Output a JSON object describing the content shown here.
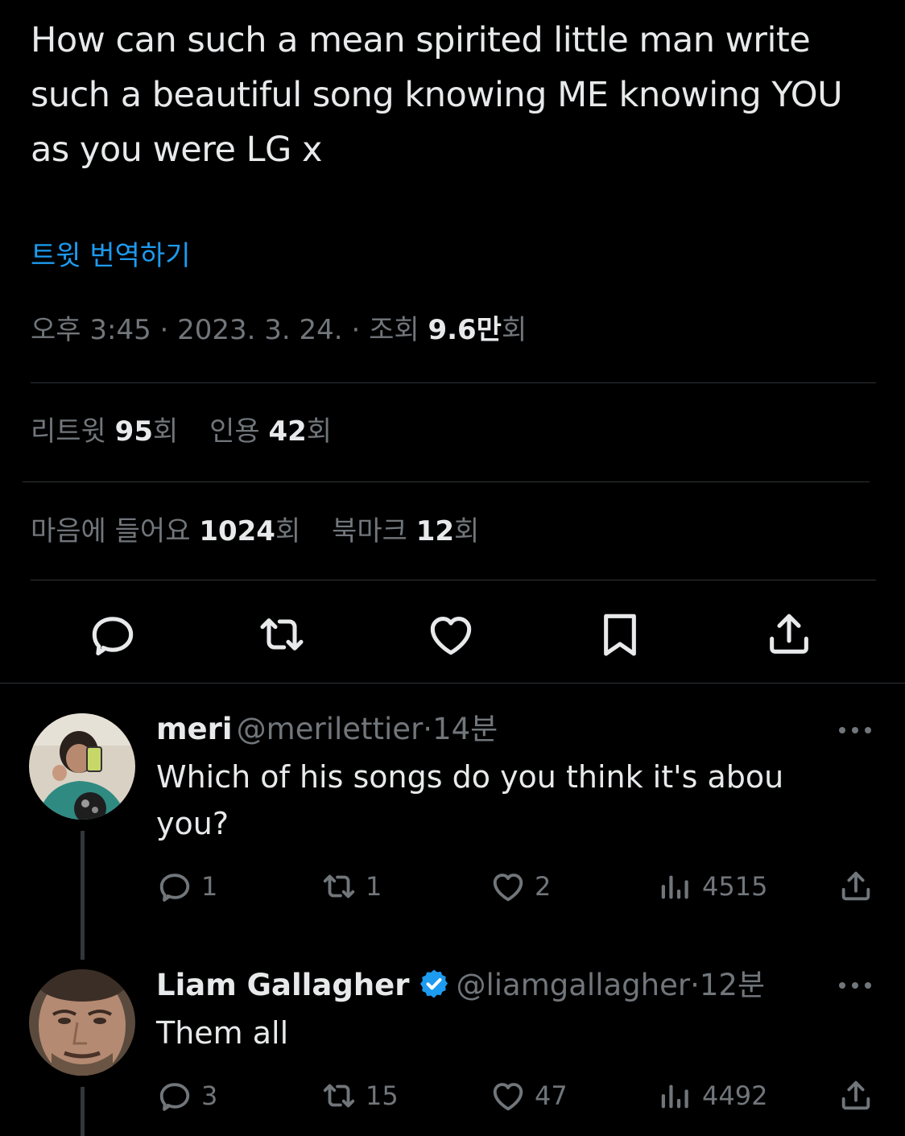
{
  "tweet": {
    "text": "How can such a mean spirited little man write such a beautiful song knowing ME knowing YOU as you were LG x",
    "translate_label": "트윗 번역하기",
    "time": "오후 3:45",
    "date": "2023. 3. 24.",
    "views_label": "조회",
    "views_value": "9.6만",
    "views_suffix": "회",
    "separator": "·",
    "retweets_label": "리트윗",
    "retweets_value": "95",
    "quotes_label": "인용",
    "quotes_value": "42",
    "likes_label": "마음에 들어요",
    "likes_value": "1024",
    "bookmarks_label": "북마크",
    "bookmarks_value": "12",
    "count_suffix": "회"
  },
  "actions": [
    "reply-icon",
    "retweet-icon",
    "like-icon",
    "bookmark-icon",
    "share-icon"
  ],
  "replies": [
    {
      "name": "meri",
      "handle": "@merilettier",
      "time": "14분",
      "text": "Which of his songs do you think it's abou you?",
      "reply_count": "1",
      "retweet_count": "1",
      "like_count": "2",
      "view_count": "4515",
      "verified": false
    },
    {
      "name": "Liam Gallagher",
      "handle": "@liamgallagher",
      "time": "12분",
      "text": "Them all",
      "reply_count": "3",
      "retweet_count": "15",
      "like_count": "47",
      "view_count": "4492",
      "verified": true
    }
  ],
  "colors": {
    "background": "#000000",
    "text": "#e7e9ea",
    "muted": "#71767b",
    "link": "#1d9bf0",
    "divider": "#2f3336",
    "verified": "#1d9bf0"
  }
}
